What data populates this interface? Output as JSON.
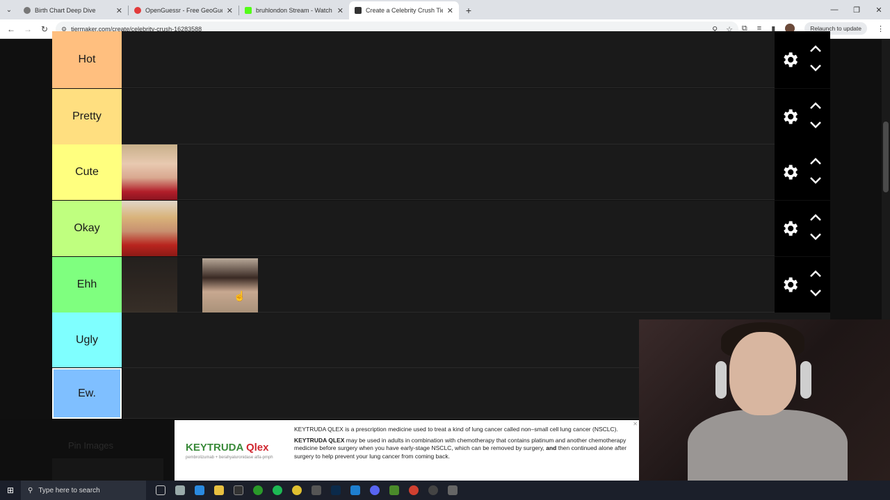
{
  "browser": {
    "tabs": [
      {
        "title": "Birth Chart Deep Dive",
        "color": "#777",
        "active": false
      },
      {
        "title": "OpenGuessr - Free GeoGuessr",
        "color": "#e23b3b",
        "active": false
      },
      {
        "title": "bruhlondon Stream - Watch Li",
        "color": "#53fc18",
        "active": false
      },
      {
        "title": "Create a Celebrity Crush Tier Li",
        "color": "#333",
        "active": true
      }
    ],
    "url": "tiermaker.com/create/celebrity-crush-16283588",
    "relaunch_label": "Relaunch to update"
  },
  "tiers": [
    {
      "label": "Hot",
      "color": "#ffbf7f"
    },
    {
      "label": "Pretty",
      "color": "#ffdf80"
    },
    {
      "label": "Cute",
      "color": "#ffff7f"
    },
    {
      "label": "Okay",
      "color": "#bfff7f"
    },
    {
      "label": "Ehh",
      "color": "#7fff7f"
    },
    {
      "label": "Ugly",
      "color": "#7fffff"
    },
    {
      "label": "Ew.",
      "color": "#7fbfff"
    }
  ],
  "pin_label": "Pin Images",
  "ad": {
    "brand_a": "KEYTRUDA",
    "brand_b": "Qlex",
    "brand_sub": "pembrolizumab + berahyaluronidase alfa-pmph",
    "p1": "KEYTRUDA QLEX is a prescription medicine used to treat a kind of lung cancer called non–small cell lung cancer (NSCLC).",
    "p2_bold": "KEYTRUDA QLEX",
    "p2": " may be used in adults in combination with chemotherapy that contains platinum and another chemotherapy medicine before surgery when you have early-stage NSCLC, which can be removed by surgery,",
    "p2_and": "and",
    "p2_end": " then continued alone after surgery to help prevent your lung cancer from coming back."
  },
  "taskbar": {
    "search_placeholder": "Type here to search"
  }
}
